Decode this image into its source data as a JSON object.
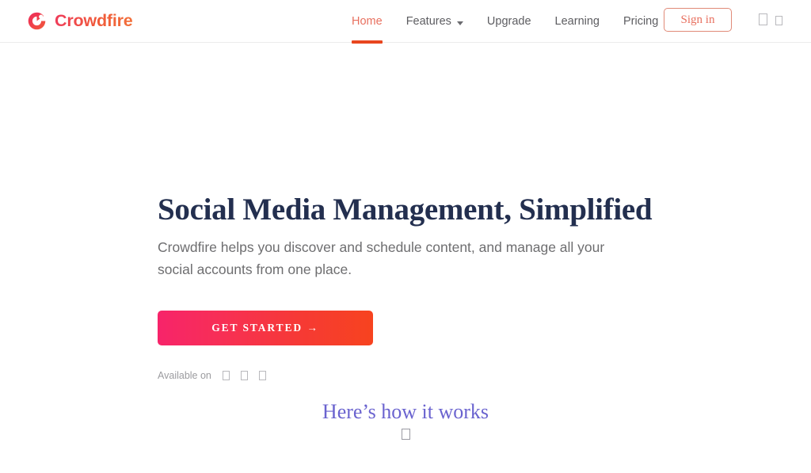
{
  "brand": {
    "name": "Crowdfire",
    "logo_icon": "crowdfire-circular-c-logo",
    "gradient_start": "#ef3b5b",
    "gradient_end": "#f2713a"
  },
  "nav": {
    "items": [
      {
        "label": "Home",
        "active": true,
        "has_caret": false
      },
      {
        "label": "Features",
        "active": false,
        "has_caret": true
      },
      {
        "label": "Upgrade",
        "active": false,
        "has_caret": false
      },
      {
        "label": "Learning",
        "active": false,
        "has_caret": false
      },
      {
        "label": "Pricing",
        "active": false,
        "has_caret": false
      }
    ],
    "active_color": "#e8705f",
    "active_underline_color": "#e8461f",
    "inactive_color": "#5d5d61",
    "signin_label": "Sign in",
    "signin_border_color": "#e08a78",
    "utility_icons": [
      "missing-glyph-box",
      "missing-glyph-box"
    ]
  },
  "hero": {
    "title": "Social Media Management, Simplified",
    "title_color": "#232f4f",
    "subtitle": "Crowdfire helps you discover and schedule content, and manage all your social accounts from one place.",
    "subtitle_color": "#6e6e70",
    "cta_label": "GET STARTED →",
    "cta_gradient_start": "#f7246a",
    "cta_gradient_end": "#f7431f",
    "available_label": "Available on",
    "available_icons": [
      "missing-glyph-box",
      "missing-glyph-box",
      "missing-glyph-box"
    ]
  },
  "how_it_works": {
    "label": "Here’s how it works",
    "color": "#6a63cf",
    "chevron_icon": "missing-glyph-box"
  }
}
